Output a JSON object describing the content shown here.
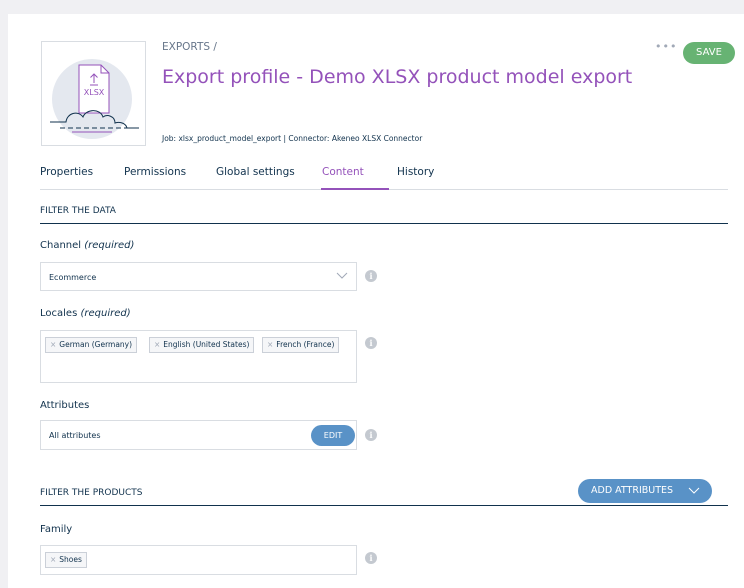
{
  "header": {
    "breadcrumb": "EXPORTS /",
    "title": "Export profile - Demo XLSX product model export",
    "job_info": "Job: xlsx_product_model_export | Connector: Akeneo XLSX Connector",
    "more_label": "•••",
    "save_label": "SAVE",
    "thumbnail_text": "XLSX",
    "thumbnail_icon": "export-file-icon"
  },
  "tabs": [
    {
      "label": "Properties",
      "active": false
    },
    {
      "label": "Permissions",
      "active": false
    },
    {
      "label": "Global settings",
      "active": false
    },
    {
      "label": "Content",
      "active": true
    },
    {
      "label": "History",
      "active": false
    }
  ],
  "filter_data": {
    "section_title": "FILTER THE DATA",
    "channel": {
      "label": "Channel",
      "required": "(required)",
      "value": "Ecommerce"
    },
    "locales": {
      "label": "Locales",
      "required": "(required)",
      "chips": [
        "German (Germany)",
        "English (United States)",
        "French (France)"
      ]
    },
    "attributes": {
      "label": "Attributes",
      "value": "All attributes",
      "edit_label": "EDIT"
    }
  },
  "filter_products": {
    "section_title": "FILTER THE PRODUCTS",
    "add_attributes_label": "ADD ATTRIBUTES",
    "family": {
      "label": "Family",
      "chips": [
        "Shoes"
      ]
    }
  },
  "chip_remove_glyph": "×",
  "info_glyph": "i",
  "colors": {
    "accent_purple": "#9452ba",
    "save_green": "#67b373",
    "button_blue": "#5992c7",
    "text_dark": "#11324d"
  }
}
